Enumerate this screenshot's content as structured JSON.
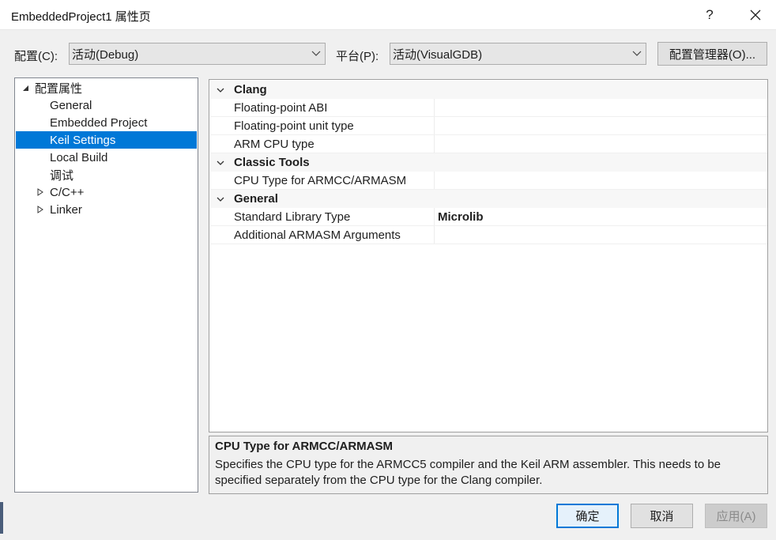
{
  "window": {
    "title": "EmbeddedProject1 属性页",
    "help_label": "?",
    "close_label": "✕"
  },
  "config_bar": {
    "config_label": "配置(C):",
    "config_value": "活动(Debug)",
    "platform_label": "平台(P):",
    "platform_value": "活动(VisualGDB)",
    "manager_label": "配置管理器(O)..."
  },
  "tree": {
    "root_label": "配置属性",
    "items": [
      {
        "label": "General"
      },
      {
        "label": "Embedded Project"
      },
      {
        "label": "Keil Settings",
        "selected": true
      },
      {
        "label": "Local Build"
      },
      {
        "label": "调试"
      },
      {
        "label": "C/C++",
        "expandable": true
      },
      {
        "label": "Linker",
        "expandable": true
      }
    ]
  },
  "grid": {
    "sections": [
      {
        "label": "Clang",
        "rows": [
          {
            "name": "Floating-point ABI",
            "value": ""
          },
          {
            "name": "Floating-point unit type",
            "value": ""
          },
          {
            "name": "ARM CPU type",
            "value": ""
          }
        ]
      },
      {
        "label": "Classic Tools",
        "rows": [
          {
            "name": "CPU Type for ARMCC/ARMASM",
            "value": ""
          }
        ]
      },
      {
        "label": "General",
        "rows": [
          {
            "name": "Standard Library Type",
            "value": "Microlib"
          },
          {
            "name": "Additional ARMASM Arguments",
            "value": ""
          }
        ]
      }
    ]
  },
  "description": {
    "title": "CPU Type for ARMCC/ARMASM",
    "body": "Specifies the CPU type for the ARMCC5 compiler and the Keil ARM assembler. This needs to be specified separately from the CPU type for the Clang compiler."
  },
  "buttons": {
    "ok": "确定",
    "cancel": "取消",
    "apply": "应用(A)"
  },
  "colors": {
    "selection": "#0078d7",
    "window_bg": "#f0f0f0"
  }
}
